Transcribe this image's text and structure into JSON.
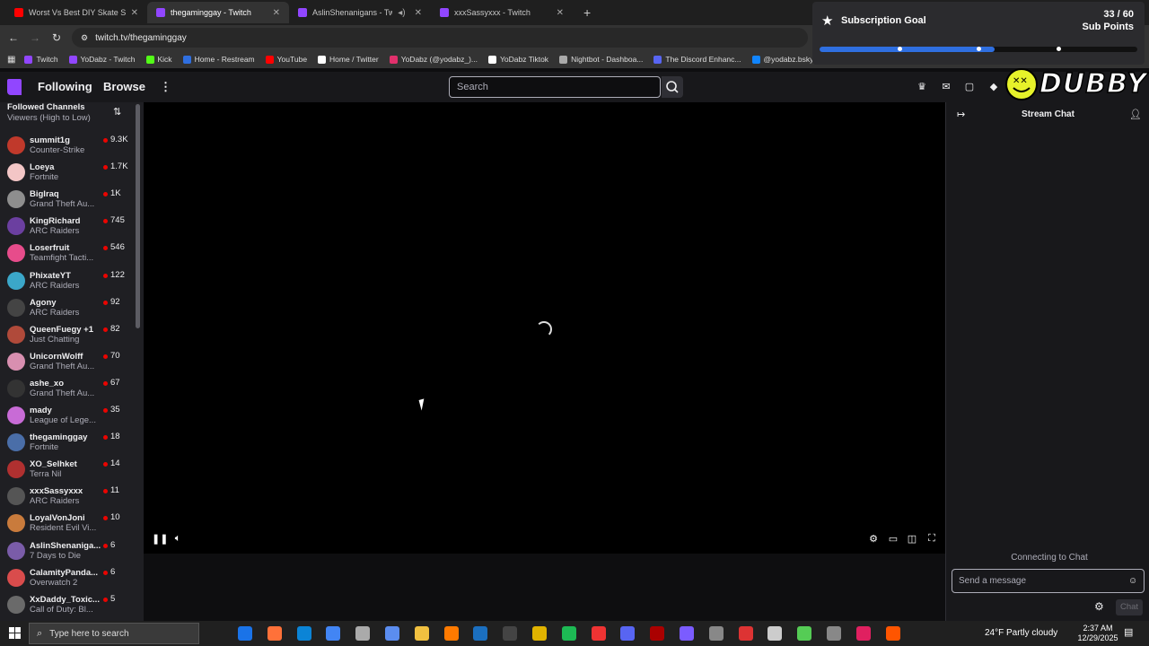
{
  "browser": {
    "tabs": [
      {
        "title": "Worst Vs Best DIY Skate Spots",
        "favicon_color": "#ff0000",
        "active": false
      },
      {
        "title": "thegaminggay - Twitch",
        "favicon_color": "#9146ff",
        "active": true
      },
      {
        "title": "AslinShenanigans - Twitch",
        "favicon_color": "#9146ff",
        "active": false
      },
      {
        "title": "xxxSassyxxx - Twitch",
        "favicon_color": "#9146ff",
        "active": false
      }
    ],
    "new_tab_label": "+",
    "url": "twitch.tv/thegaminggay",
    "bookmarks": [
      {
        "label": "Twitch",
        "color": "#9146ff"
      },
      {
        "label": "YoDabz - Twitch",
        "color": "#9146ff"
      },
      {
        "label": "Kick",
        "color": "#53fc18"
      },
      {
        "label": "Home - Restream",
        "color": "#2f6fe0"
      },
      {
        "label": "YouTube",
        "color": "#ff0000"
      },
      {
        "label": "Home / Twitter",
        "color": "#ffffff"
      },
      {
        "label": "YoDabz (@yodabz_)...",
        "color": "#e1306c"
      },
      {
        "label": "YoDabz Tiktok",
        "color": "#ffffff"
      },
      {
        "label": "Nightbot - Dashboa...",
        "color": "#aaaaaa"
      },
      {
        "label": "The Discord Enhanc...",
        "color": "#5865f2"
      },
      {
        "label": "@yodabz.bsky.socia...",
        "color": "#1185fe"
      }
    ]
  },
  "twitch_nav": {
    "following": "Following",
    "browse": "Browse",
    "more": "⋮",
    "search_placeholder": "Search"
  },
  "sidebar": {
    "heading": "Followed Channels",
    "sort": "Viewers (High to Low)",
    "channels": [
      {
        "name": "summit1g",
        "game": "Counter-Strike",
        "viewers": "9.3K",
        "color": "#c0392b"
      },
      {
        "name": "Loeya",
        "game": "Fortnite",
        "viewers": "1.7K",
        "color": "#f3c6c6"
      },
      {
        "name": "Biglraq",
        "game": "Grand Theft Au...",
        "viewers": "1K",
        "color": "#8e8e8e"
      },
      {
        "name": "KingRichard",
        "game": "ARC Raiders",
        "viewers": "745",
        "color": "#6b3fa0"
      },
      {
        "name": "Loserfruit",
        "game": "Teamfight Tacti...",
        "viewers": "546",
        "color": "#e74c8b"
      },
      {
        "name": "PhixateYT",
        "game": "ARC Raiders",
        "viewers": "122",
        "color": "#3ba7c9"
      },
      {
        "name": "Agony",
        "game": "ARC Raiders",
        "viewers": "92",
        "color": "#444444"
      },
      {
        "name": "QueenFuegy +1",
        "game": "Just Chatting",
        "viewers": "82",
        "color": "#b04a3a"
      },
      {
        "name": "UnicornWolff",
        "game": "Grand Theft Au...",
        "viewers": "70",
        "color": "#d88fb0"
      },
      {
        "name": "ashe_xo",
        "game": "Grand Theft Au...",
        "viewers": "67",
        "color": "#333333"
      },
      {
        "name": "mady",
        "game": "League of Lege...",
        "viewers": "35",
        "color": "#c86bd6"
      },
      {
        "name": "thegaminggay",
        "game": "Fortnite",
        "viewers": "18",
        "color": "#4a6ea8"
      },
      {
        "name": "XO_Selhket",
        "game": "Terra Nil",
        "viewers": "14",
        "color": "#b03030"
      },
      {
        "name": "xxxSassyxxx",
        "game": "ARC Raiders",
        "viewers": "11",
        "color": "#555555"
      },
      {
        "name": "LoyalVonJoni",
        "game": "Resident Evil Vi...",
        "viewers": "10",
        "color": "#c97b3c"
      },
      {
        "name": "AslinShenaniga...",
        "game": "7 Days to Die",
        "viewers": "6",
        "color": "#7a5ca8"
      },
      {
        "name": "CalamityPanda...",
        "game": "Overwatch 2",
        "viewers": "6",
        "color": "#d94c4c"
      },
      {
        "name": "XxDaddy_Toxic...",
        "game": "Call of Duty: Bl...",
        "viewers": "5",
        "color": "#6a6a6a"
      }
    ]
  },
  "chat": {
    "title": "Stream Chat",
    "status": "Connecting to Chat",
    "input_placeholder": "Send a message",
    "send_label": "Chat"
  },
  "sub_goal": {
    "title": "Subscription Goal",
    "count": "33 / 60",
    "unit": "Sub Points",
    "progress": 0.55,
    "milestones": [
      0.25,
      0.5,
      0.75
    ],
    "bar_color": "#2f6fe0"
  },
  "overlay": {
    "brand": "DUBBY"
  },
  "taskbar": {
    "search_placeholder": "Type here to search",
    "weather": "24°F  Partly cloudy",
    "time": "2:37 AM",
    "date": "12/29/2025",
    "icons": [
      "#1a73e8",
      "#ff7139",
      "#0b84d6",
      "#4285f4",
      "#aaaaaa",
      "#5b8def",
      "#f0c040",
      "#ff7a00",
      "#1b6fbf",
      "#444444",
      "#e0b300",
      "#1db954",
      "#e33",
      "#5865f2",
      "#aa0000",
      "#7b5cff",
      "#888888",
      "#d33",
      "#cccccc",
      "#55cc55",
      "#888888",
      "#e02060",
      "#ff5500"
    ]
  }
}
